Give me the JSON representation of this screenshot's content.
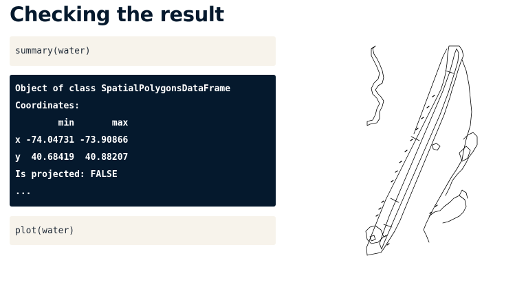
{
  "slide": {
    "title": "Checking the result"
  },
  "code_blocks": {
    "summary_call": "summary(water)",
    "plot_call": "plot(water)"
  },
  "console_output": {
    "lines": [
      "Object of class SpatialPolygonsDataFrame",
      "Coordinates:",
      "        min       max",
      "x -74.04731 -73.90866",
      "y  40.68419  40.88207",
      "Is projected: FALSE",
      "..."
    ]
  },
  "plot": {
    "description_icon": "manhattan-water-polygons-map",
    "stroke_color": "#000000",
    "fill_color": "#ffffff"
  },
  "colors": {
    "title": "#05192d",
    "code_bg": "#f7f3eb",
    "console_bg": "#05192d",
    "console_text": "#ffffff"
  }
}
